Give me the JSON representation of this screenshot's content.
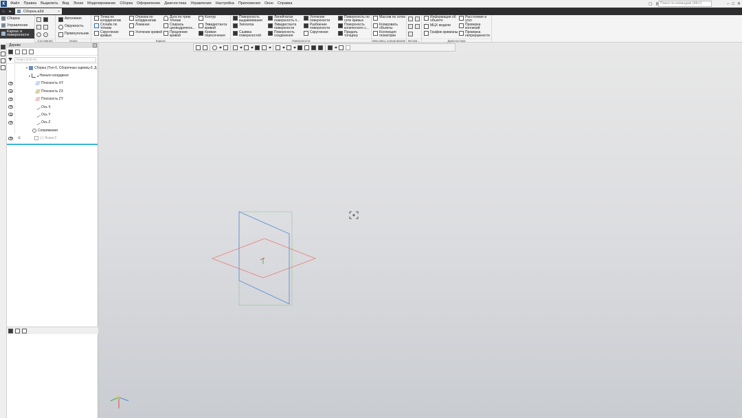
{
  "menu": {
    "logo": "К",
    "items": [
      "Файл",
      "Правка",
      "Выделить",
      "Вид",
      "Эскиз",
      "Моделирование",
      "Сборка",
      "Оформление",
      "Диагностика",
      "Управление",
      "Настройка",
      "Приложения",
      "Окно",
      "Справка"
    ],
    "search_placeholder": "Поиск по командам (Alt+/)",
    "window_min": "–",
    "window_max": "□",
    "window_close": "✕"
  },
  "tabbar": {
    "home_icon": "home-icon",
    "doc_tab_label": "Сборка.a3d",
    "doc_tab_close": "×"
  },
  "ribbon": {
    "left_items": [
      "Сборка",
      "Управление",
      "Каркас и поверхности"
    ],
    "groups": {
      "sostavnaya": {
        "caption": "Составная"
      },
      "eskiz": {
        "caption": "Эскиз",
        "buttons": [
          "Автолиния",
          "Окружность",
          "Прямоугольник"
        ]
      },
      "karkas": {
        "caption": "Каркас",
        "col1": [
          "Точка по координатам",
          "Сплайн по точкам",
          "Скругление кривых"
        ],
        "col2": [
          "Отрезок по координатам",
          "Ломаная",
          "Усечение кривой"
        ],
        "col3": [
          "Дуга по трем точкам",
          "Спираль цилиндрическ...",
          "Продление кривой"
        ],
        "col4": [
          "Контур",
          "Эквидистанта кривой",
          "Кривая пересечения"
        ]
      },
      "poverhnosti": {
        "caption": "Поверхности",
        "col1": [
          "Поверхность выдавливания",
          "Заплатка",
          "Сшивка поверхностей"
        ],
        "col2": [
          "Линейчатая поверхность п...",
          "Эквидистанта поверхности",
          "Поверхность соединения"
        ],
        "col3": [
          "Усечение поверхности",
          "Разбиение поверхности",
          "Скругление"
        ],
        "col4": [
          "Поверхность по сети кривых",
          "Поверхность конического с...",
          "Придать толщину"
        ]
      },
      "massivy": {
        "caption": "Массивы, копирование",
        "buttons": [
          "Массив по сетке",
          "Копировать объекты",
          "Коллекция геометрии"
        ]
      },
      "vspom": {
        "caption": "Вспом..."
      },
      "diagnostika": {
        "caption": "Диагностика",
        "col1": [
          "Информация об объекте",
          "МЦХ модели",
          "График кривизны"
        ],
        "col2": [
          "Расстояние и угол",
          "Проверка коллизий",
          "Проверка непрерывности"
        ]
      }
    }
  },
  "tree": {
    "title": "Дерево",
    "search_placeholder": "Поиск (Ctrl+F)",
    "root": "Сборка (Тел-0, Сборочных единиц-0, Д",
    "origin": "Начало координат",
    "items": [
      "Плоскость XY",
      "Плоскость ZX",
      "Плоскость ZY",
      "Ось X",
      "Ось Y",
      "Ось Z"
    ],
    "constraints": "Сопряжения",
    "sketch": "(-) Эскиз:2"
  },
  "colors": {
    "plane_xy": "#e8837f",
    "plane_zx": "#7fc97f",
    "plane_zy": "#5b8fd6",
    "accent": "#39b4d6"
  }
}
